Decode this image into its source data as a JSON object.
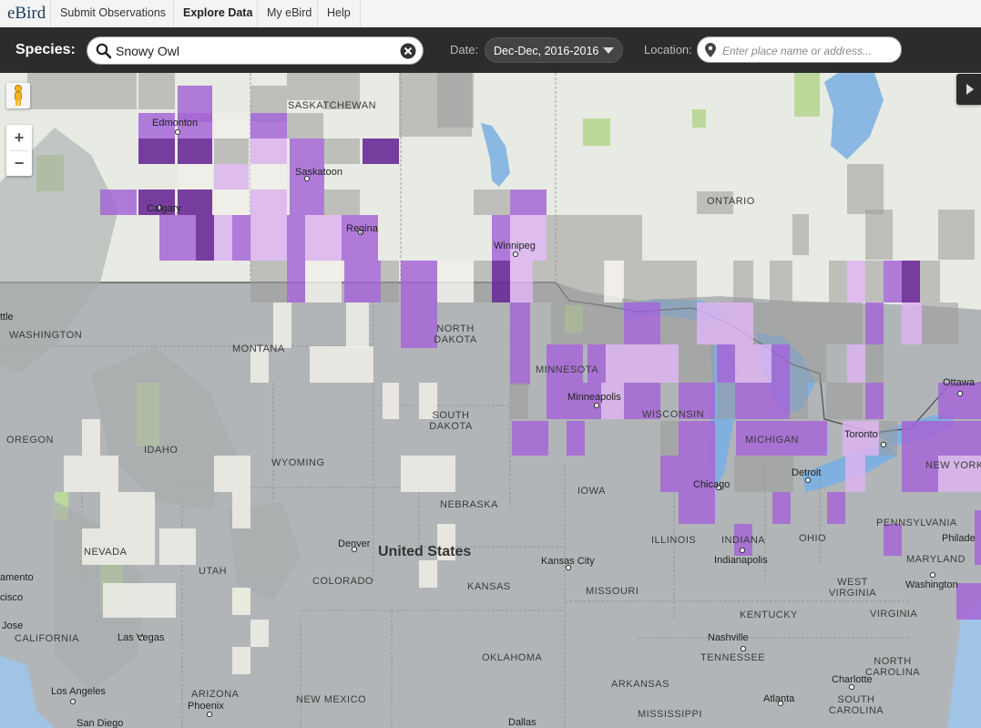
{
  "nav": {
    "logo": "eBird",
    "items": [
      {
        "label": "Submit Observations",
        "active": false
      },
      {
        "label": "Explore Data",
        "active": true
      },
      {
        "label": "My eBird",
        "active": false
      },
      {
        "label": "Help",
        "active": false
      }
    ]
  },
  "search": {
    "species_label": "Species:",
    "species_value": "Snowy Owl",
    "date_label": "Date:",
    "date_value": "Dec-Dec, 2016-2016",
    "location_label": "Location:",
    "location_placeholder": "Enter place name or address..."
  },
  "map": {
    "zoom_in": "+",
    "zoom_out": "−",
    "country_label": "United States",
    "regions": [
      "SASKATCHEWAN",
      "ONTARIO",
      "WASHINGTON",
      "MONTANA",
      "NORTH DAKOTA",
      "MINNESOTA",
      "SOUTH DAKOTA",
      "WISCONSIN",
      "MICHIGAN",
      "OREGON",
      "IDAHO",
      "WYOMING",
      "NEBRASKA",
      "IOWA",
      "ILLINOIS",
      "INDIANA",
      "OHIO",
      "PENNSYLVANIA",
      "NEW YORK",
      "NEVADA",
      "UTAH",
      "COLORADO",
      "KANSAS",
      "MISSOURI",
      "KENTUCKY",
      "WEST VIRGINIA",
      "VIRGINIA",
      "MARYLAND",
      "CALIFORNIA",
      "ARIZONA",
      "NEW MEXICO",
      "OKLAHOMA",
      "ARKANSAS",
      "TENNESSEE",
      "NORTH CAROLINA",
      "SOUTH CAROLINA",
      "MISSISSIPPI"
    ],
    "cities": [
      "Edmonton",
      "Saskatoon",
      "Calgary",
      "Regina",
      "Winnipeg",
      "Minneapolis",
      "Toronto",
      "Ottawa",
      "Detroit",
      "Chicago",
      "Denver",
      "Kansas City",
      "Indianapolis",
      "Washington",
      "Nashville",
      "Charlotte",
      "Atlanta",
      "Las Vegas",
      "Los Angeles",
      "Phoenix",
      "San Diego",
      "Dallas",
      "Philade",
      "ttle",
      "amento",
      "cisco",
      "Jose"
    ]
  },
  "colors": {
    "nav_bg": "#f4f4f4",
    "search_bg": "#2c2c2c",
    "frequency_low": "#dcb4f0",
    "frequency_mid": "#a466d6",
    "frequency_high": "#6a2a96",
    "no_observations": "#9a9a9a"
  }
}
